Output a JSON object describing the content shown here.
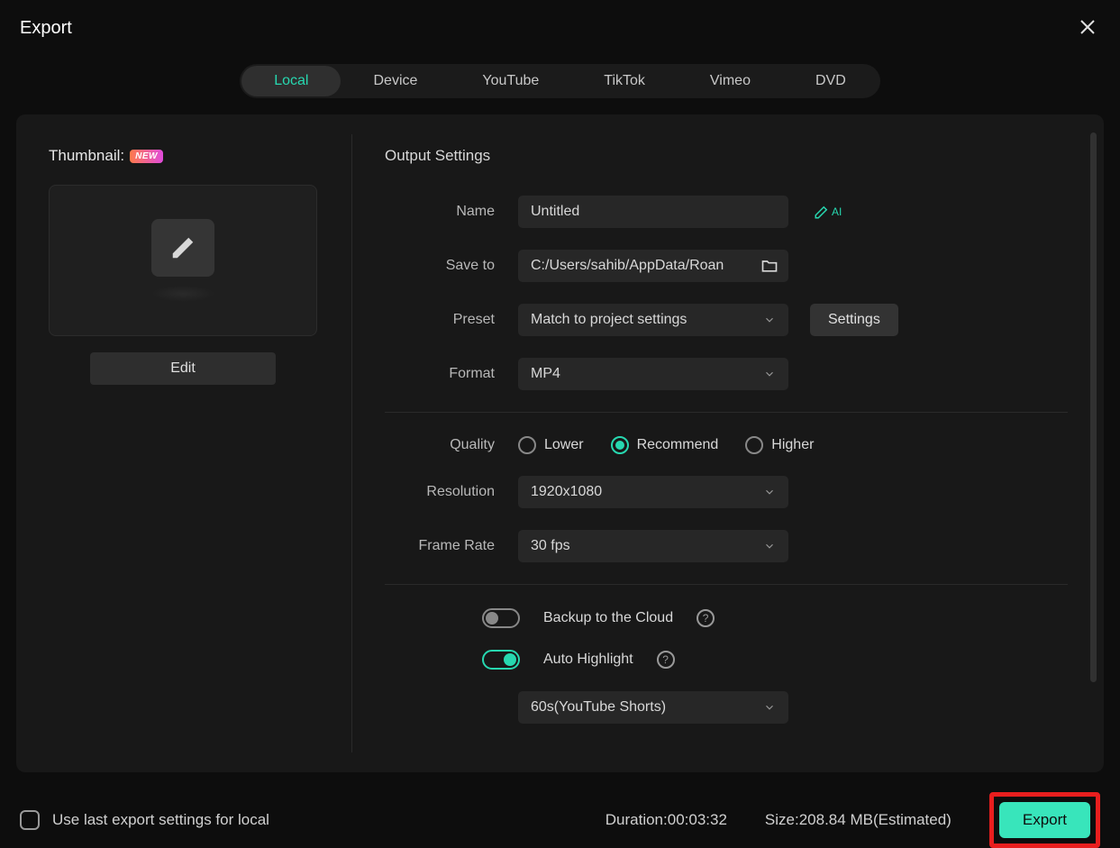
{
  "header": {
    "title": "Export"
  },
  "tabs": [
    "Local",
    "Device",
    "YouTube",
    "TikTok",
    "Vimeo",
    "DVD"
  ],
  "activeTab": 0,
  "thumbnail": {
    "label": "Thumbnail:",
    "badge": "NEW",
    "editLabel": "Edit"
  },
  "output": {
    "sectionTitle": "Output Settings",
    "nameLabel": "Name",
    "nameValue": "Untitled",
    "aiLabel": "AI",
    "saveToLabel": "Save to",
    "saveToValue": "C:/Users/sahib/AppData/Roan",
    "presetLabel": "Preset",
    "presetValue": "Match to project settings",
    "settingsLabel": "Settings",
    "formatLabel": "Format",
    "formatValue": "MP4",
    "qualityLabel": "Quality",
    "qualityOptions": [
      "Lower",
      "Recommend",
      "Higher"
    ],
    "qualitySelected": 1,
    "resolutionLabel": "Resolution",
    "resolutionValue": "1920x1080",
    "frameRateLabel": "Frame Rate",
    "frameRateValue": "30 fps",
    "backupLabel": "Backup to the Cloud",
    "backupOn": false,
    "autoHighlightLabel": "Auto Highlight",
    "autoHighlightOn": true,
    "highlightPresetValue": "60s(YouTube Shorts)"
  },
  "footer": {
    "useLastLabel": "Use last export settings for local",
    "durationLabel": "Duration:",
    "durationValue": "00:03:32",
    "sizeLabel": "Size:",
    "sizeValue": "208.84 MB(Estimated)",
    "exportLabel": "Export"
  }
}
